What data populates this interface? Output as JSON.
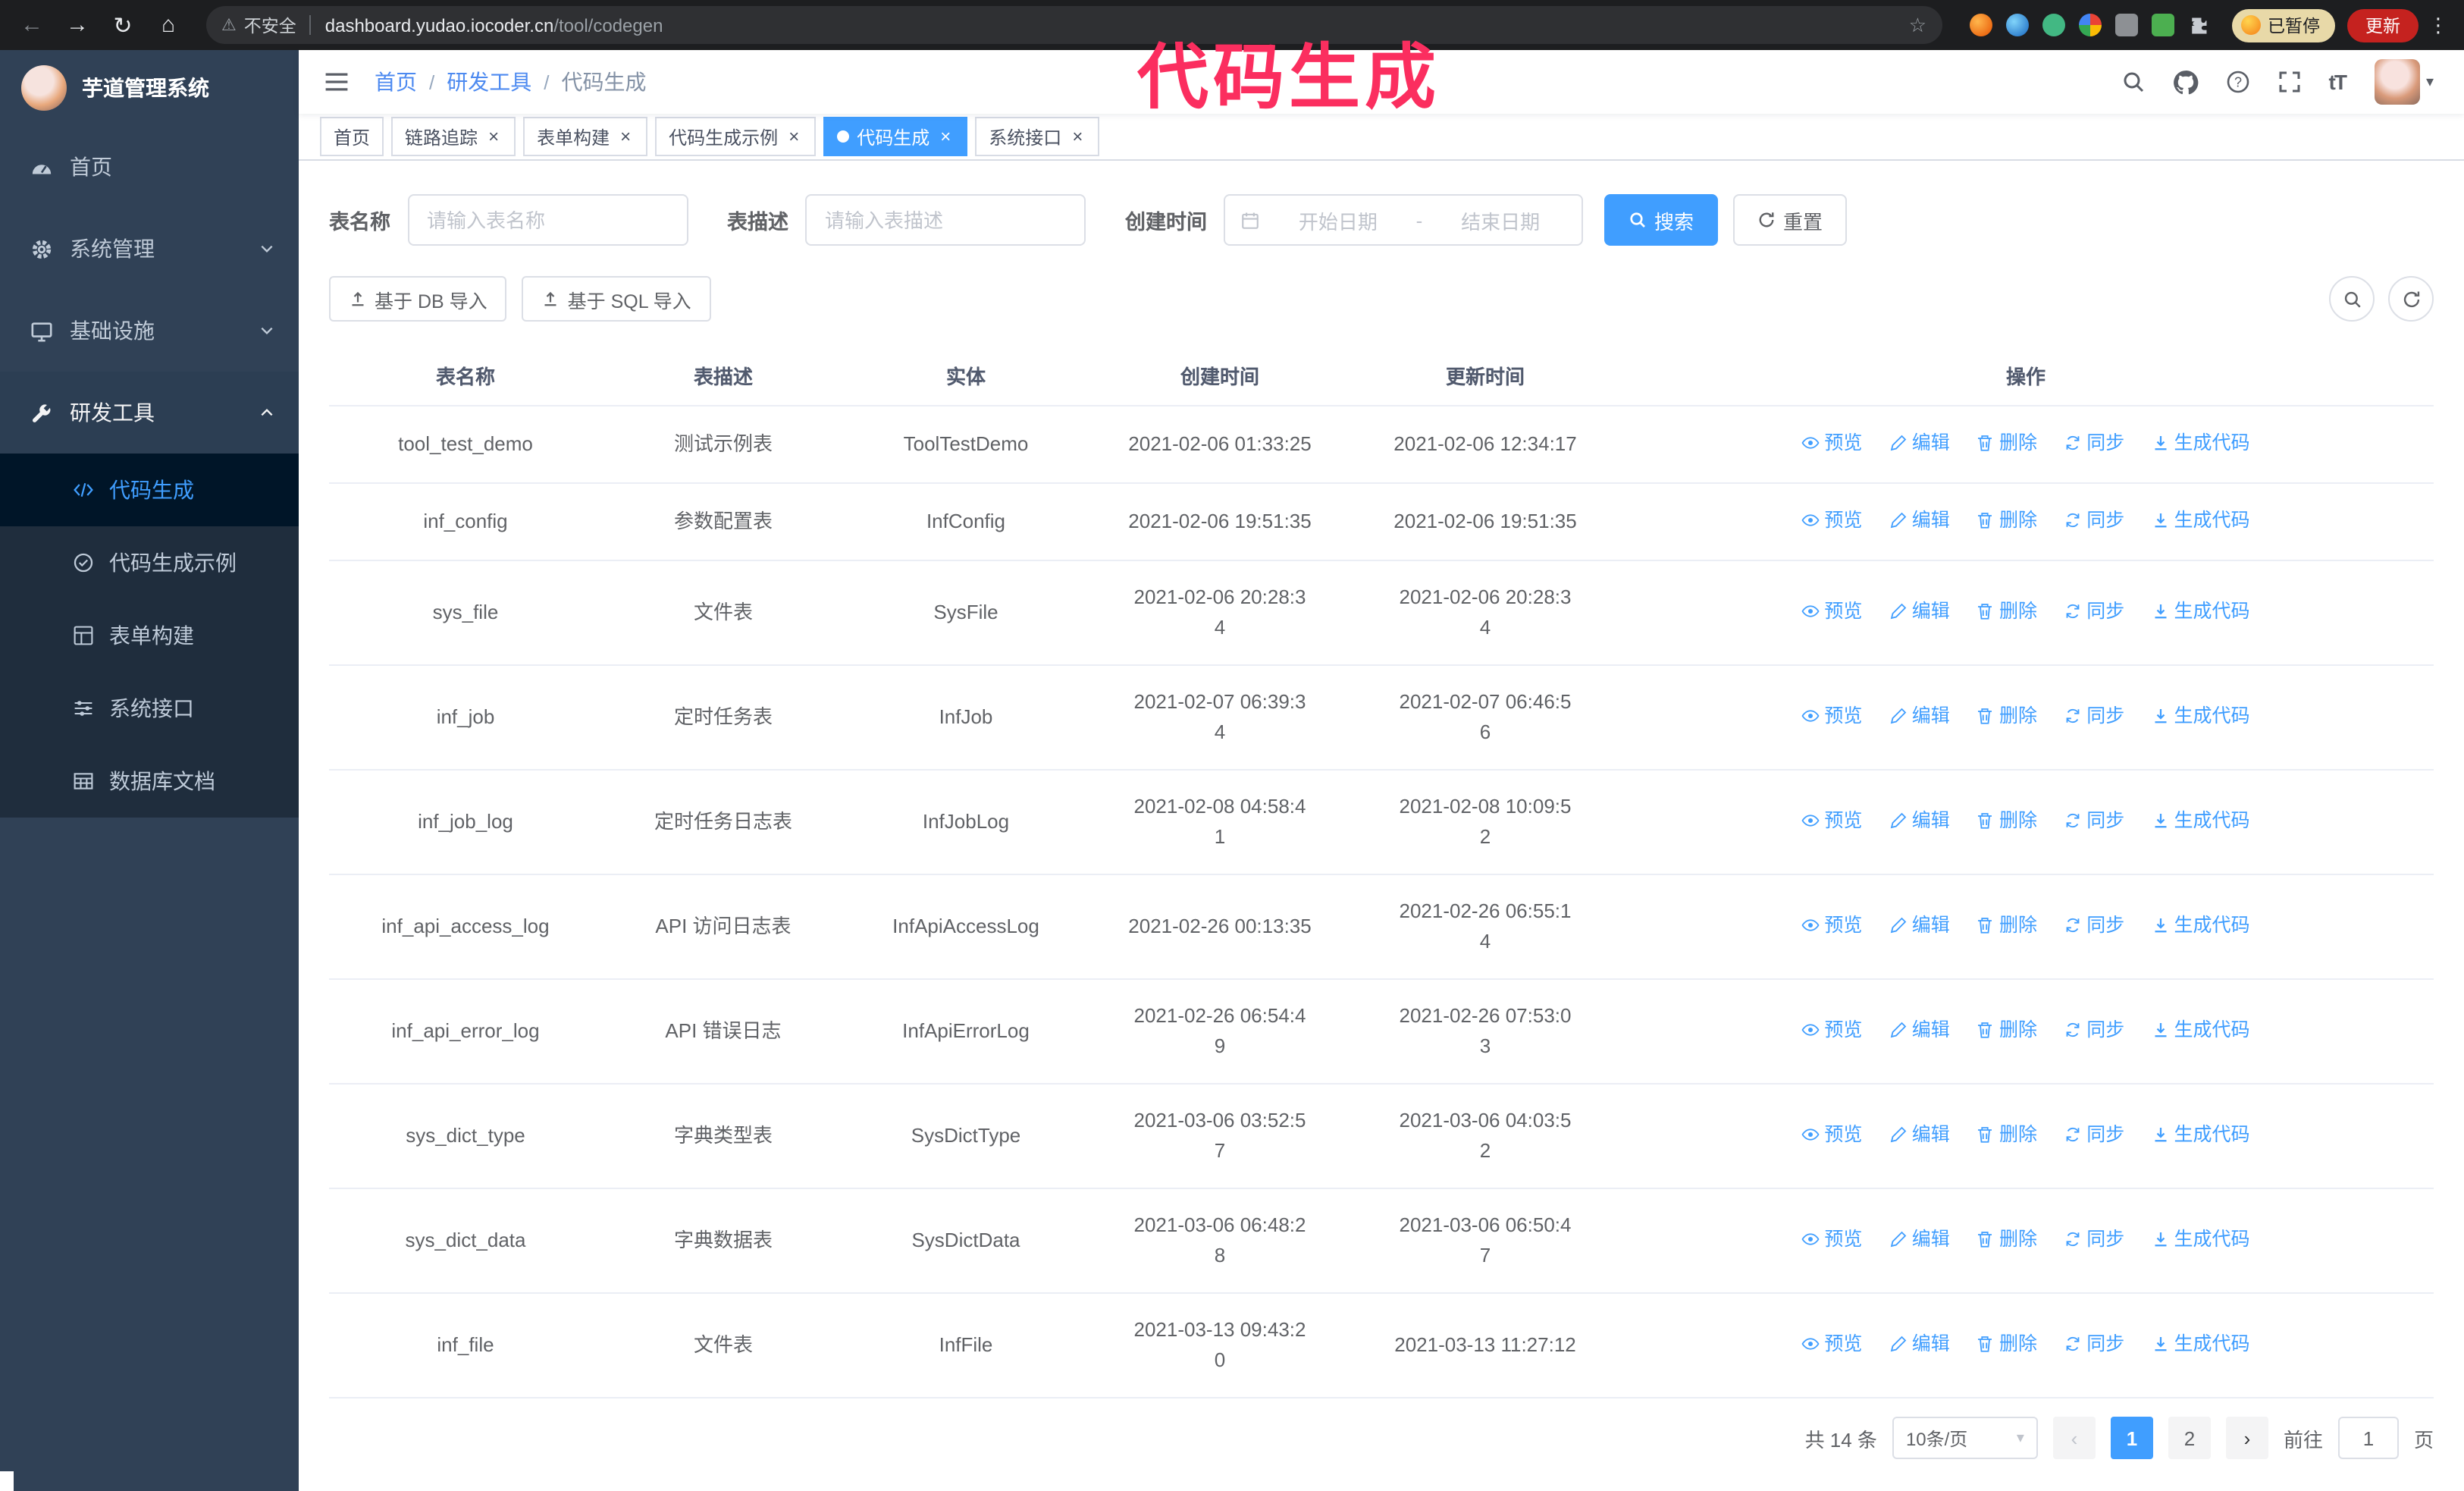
{
  "colors": {
    "accent": "#409eff",
    "sidebar_bg": "#304156",
    "submenu_bg": "#1f2d3d",
    "submenu_active_bg": "#001528",
    "annotation": "#fb2e5f",
    "chrome_bg": "#1d1e20"
  },
  "browser": {
    "security_label": "不安全",
    "url_host": "dashboard.yudao.iocoder.cn",
    "url_path": "/tool/codegen",
    "paused_badge": "已暂停",
    "update_button": "更新"
  },
  "annotation": {
    "text": "代码生成"
  },
  "sidebar": {
    "title": "芋道管理系统",
    "items": [
      {
        "label": "首页"
      },
      {
        "label": "系统管理"
      },
      {
        "label": "基础设施"
      },
      {
        "label": "研发工具"
      }
    ],
    "submenu": [
      {
        "label": "代码生成"
      },
      {
        "label": "代码生成示例"
      },
      {
        "label": "表单构建"
      },
      {
        "label": "系统接口"
      },
      {
        "label": "数据库文档"
      }
    ]
  },
  "navbar": {
    "breadcrumb": [
      "首页",
      "研发工具",
      "代码生成"
    ]
  },
  "tabs": [
    {
      "label": "首页"
    },
    {
      "label": "链路追踪"
    },
    {
      "label": "表单构建"
    },
    {
      "label": "代码生成示例"
    },
    {
      "label": "代码生成"
    },
    {
      "label": "系统接口"
    }
  ],
  "filters": {
    "name_label": "表名称",
    "name_placeholder": "请输入表名称",
    "desc_label": "表描述",
    "desc_placeholder": "请输入表描述",
    "time_label": "创建时间",
    "start_placeholder": "开始日期",
    "range_separator": "-",
    "end_placeholder": "结束日期",
    "search_button": "搜索",
    "reset_button": "重置"
  },
  "toolbar": {
    "import_db_button": "基于 DB 导入",
    "import_sql_button": "基于 SQL 导入"
  },
  "table": {
    "columns": [
      "表名称",
      "表描述",
      "实体",
      "创建时间",
      "更新时间",
      "操作"
    ],
    "actions": [
      "预览",
      "编辑",
      "删除",
      "同步",
      "生成代码"
    ],
    "rows": [
      {
        "name": "tool_test_demo",
        "desc": "测试示例表",
        "entity": "ToolTestDemo",
        "created": "2021-02-06 01:33:25",
        "updated": "2021-02-06 12:34:17"
      },
      {
        "name": "inf_config",
        "desc": "参数配置表",
        "entity": "InfConfig",
        "created": "2021-02-06 19:51:35",
        "updated": "2021-02-06 19:51:35"
      },
      {
        "name": "sys_file",
        "desc": "文件表",
        "entity": "SysFile",
        "created": "2021-02-06 20:28:3\n4",
        "updated": "2021-02-06 20:28:3\n4"
      },
      {
        "name": "inf_job",
        "desc": "定时任务表",
        "entity": "InfJob",
        "created": "2021-02-07 06:39:3\n4",
        "updated": "2021-02-07 06:46:5\n6"
      },
      {
        "name": "inf_job_log",
        "desc": "定时任务日志表",
        "entity": "InfJobLog",
        "created": "2021-02-08 04:58:4\n1",
        "updated": "2021-02-08 10:09:5\n2"
      },
      {
        "name": "inf_api_access_log",
        "desc": "API 访问日志表",
        "entity": "InfApiAccessLog",
        "created": "2021-02-26 00:13:35",
        "updated": "2021-02-26 06:55:1\n4"
      },
      {
        "name": "inf_api_error_log",
        "desc": "API 错误日志",
        "entity": "InfApiErrorLog",
        "created": "2021-02-26 06:54:4\n9",
        "updated": "2021-02-26 07:53:0\n3"
      },
      {
        "name": "sys_dict_type",
        "desc": "字典类型表",
        "entity": "SysDictType",
        "created": "2021-03-06 03:52:5\n7",
        "updated": "2021-03-06 04:03:5\n2"
      },
      {
        "name": "sys_dict_data",
        "desc": "字典数据表",
        "entity": "SysDictData",
        "created": "2021-03-06 06:48:2\n8",
        "updated": "2021-03-06 06:50:4\n7"
      },
      {
        "name": "inf_file",
        "desc": "文件表",
        "entity": "InfFile",
        "created": "2021-03-13 09:43:2\n0",
        "updated": "2021-03-13 11:27:12"
      }
    ]
  },
  "pagination": {
    "total_label": "共 14 条",
    "page_size": "10条/页",
    "pages": [
      "1",
      "2"
    ],
    "active_page": "1",
    "goto_label": "前往",
    "goto_value": "1",
    "goto_unit": "页"
  }
}
